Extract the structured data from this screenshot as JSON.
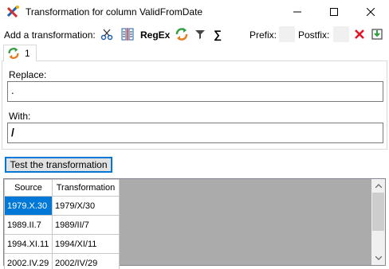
{
  "window": {
    "title": "Transformation for column ValidFromDate"
  },
  "toolbar": {
    "add_label": "Add a transformation:",
    "regex_label": "RegEx",
    "sigma_label": "∑",
    "prefix_label": "Prefix:",
    "postfix_label": "Postfix:",
    "prefix_value": "",
    "postfix_value": ""
  },
  "tab": {
    "label": "1"
  },
  "form": {
    "replace_label": "Replace:",
    "replace_value": ".",
    "with_label": "With:",
    "with_value": "/"
  },
  "test_button_label": "Test the transformation",
  "grid": {
    "columns": [
      "Source",
      "Transformation"
    ],
    "rows": [
      [
        "1979.X.30",
        "1979/X/30"
      ],
      [
        "1989.II.7",
        "1989/II/7"
      ],
      [
        "1994.XI.11",
        "1994/XI/11"
      ],
      [
        "2002.IV.29",
        "2002/IV/29"
      ]
    ]
  },
  "colors": {
    "selection": "#0078d7",
    "grid_background": "#ababab",
    "delete_red": "#e81123"
  }
}
